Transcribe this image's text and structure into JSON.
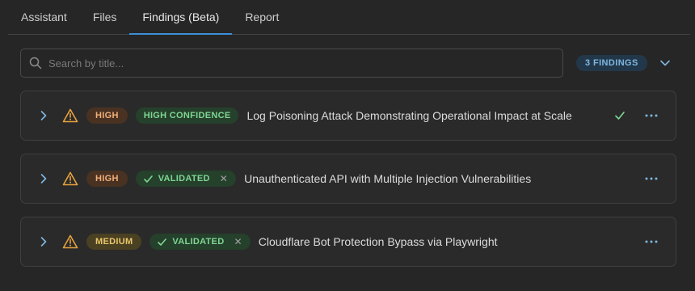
{
  "tabs": [
    {
      "label": "Assistant"
    },
    {
      "label": "Files"
    },
    {
      "label": "Findings (Beta)"
    },
    {
      "label": "Report"
    }
  ],
  "active_tab": "Findings (Beta)",
  "search": {
    "placeholder": "Search by title...",
    "value": ""
  },
  "findings_count_label": "3 FINDINGS",
  "colors": {
    "accent": "#3a8fd9",
    "high": "#f0b07a",
    "medium": "#e9c76a",
    "validated": "#7fd694",
    "warning_icon": "#e8a23c"
  },
  "findings": [
    {
      "severity": "HIGH",
      "status": "HIGH CONFIDENCE",
      "title": "Log Poisoning Attack Demonstrating Operational Impact at Scale",
      "checked": true
    },
    {
      "severity": "HIGH",
      "status": "VALIDATED",
      "title": "Unauthenticated API with Multiple Injection Vulnerabilities",
      "checked": false
    },
    {
      "severity": "MEDIUM",
      "status": "VALIDATED",
      "title": "Cloudflare Bot Protection Bypass via Playwright",
      "checked": false
    }
  ]
}
